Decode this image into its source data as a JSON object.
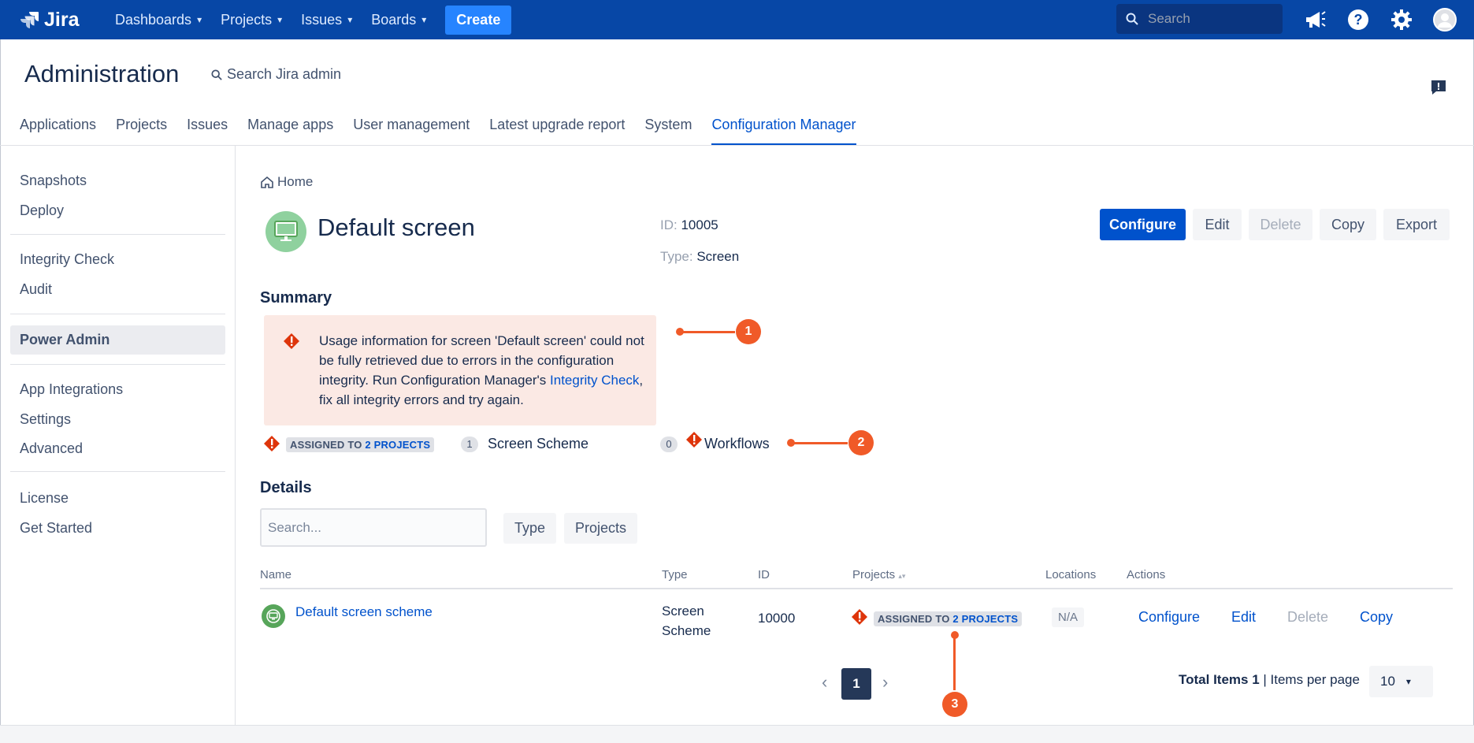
{
  "topbar": {
    "logo_text": "Jira",
    "nav": [
      {
        "label": "Dashboards"
      },
      {
        "label": "Projects"
      },
      {
        "label": "Issues"
      },
      {
        "label": "Boards"
      }
    ],
    "create_label": "Create",
    "search_placeholder": "Search",
    "colors": {
      "bar": "#0747a6",
      "create": "#2684ff"
    }
  },
  "admin": {
    "title": "Administration",
    "search_label": "Search Jira admin",
    "tabs": [
      {
        "label": "Applications"
      },
      {
        "label": "Projects"
      },
      {
        "label": "Issues"
      },
      {
        "label": "Manage apps"
      },
      {
        "label": "User management"
      },
      {
        "label": "Latest upgrade report"
      },
      {
        "label": "System"
      },
      {
        "label": "Configuration Manager"
      }
    ],
    "active_tab": "Configuration Manager"
  },
  "sidebar": {
    "items": [
      {
        "label": "Snapshots"
      },
      {
        "label": "Deploy"
      },
      {
        "label": "Integrity Check"
      },
      {
        "label": "Audit"
      },
      {
        "label": "Power Admin"
      },
      {
        "label": "App Integrations"
      },
      {
        "label": "Settings"
      },
      {
        "label": "Advanced"
      },
      {
        "label": "License"
      },
      {
        "label": "Get Started"
      }
    ],
    "active": "Power Admin"
  },
  "main": {
    "breadcrumb": "Home",
    "title": "Default screen",
    "meta": {
      "id_label": "ID:",
      "id_value": "10005",
      "type_label": "Type:",
      "type_value": "Screen"
    },
    "buttons": {
      "configure": "Configure",
      "edit": "Edit",
      "delete": "Delete",
      "copy": "Copy",
      "export": "Export"
    },
    "summary": {
      "heading": "Summary",
      "warning_text": "Usage information for screen 'Default screen' could not be fully retrieved due to errors in the configuration integrity. Run Configuration Manager's ",
      "warning_link": "Integrity Check",
      "warning_tail": ", fix all integrity errors and try again.",
      "assigned_prefix": "ASSIGNED TO ",
      "assigned_link": "2 PROJECTS",
      "screen_scheme_count": "1",
      "screen_scheme_label": "Screen Scheme",
      "workflows_count": "0",
      "workflows_label": "Workflows"
    },
    "details": {
      "heading": "Details",
      "search_placeholder": "Search...",
      "filters": [
        {
          "label": "Type"
        },
        {
          "label": "Projects"
        }
      ],
      "columns": {
        "name": "Name",
        "type": "Type",
        "id": "ID",
        "projects": "Projects",
        "locations": "Locations",
        "actions": "Actions"
      },
      "rows": [
        {
          "name": "Default screen scheme",
          "type_line1": "Screen",
          "type_line2": "Scheme",
          "id": "10000",
          "projects_prefix": "ASSIGNED TO ",
          "projects_link": "2 PROJECTS",
          "locations": "N/A",
          "actions": {
            "configure": "Configure",
            "edit": "Edit",
            "delete": "Delete",
            "copy": "Copy"
          }
        }
      ]
    },
    "pagination": {
      "current_page": "1",
      "total_label": "Total Items 1",
      "per_page_label": "| Items per page",
      "per_page_value": "10"
    },
    "callouts": [
      "1",
      "2",
      "3"
    ],
    "colors": {
      "primary": "#0052cc",
      "warning_bg": "#fbe9e4",
      "callout": "#f05a28",
      "error_icon": "#de350b"
    }
  }
}
